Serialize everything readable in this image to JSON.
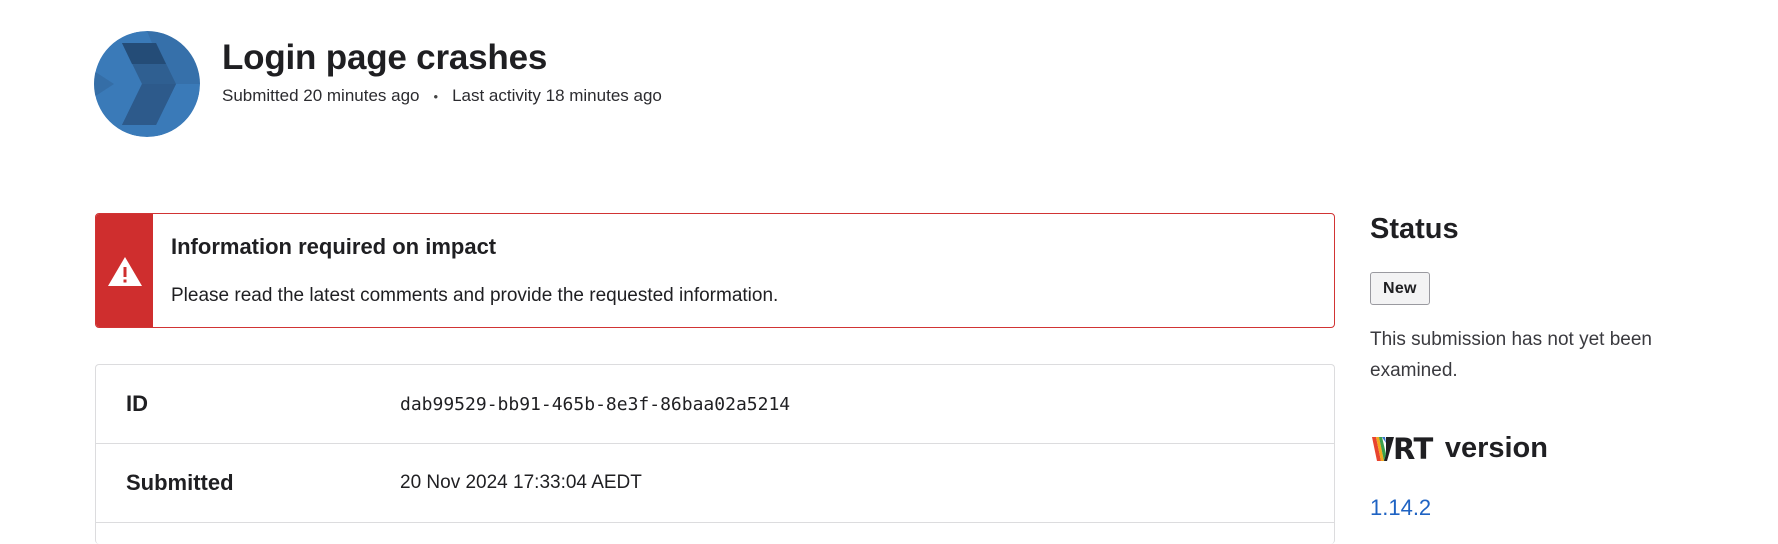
{
  "header": {
    "title": "Login page crashes",
    "submitted": "Submitted 20 minutes ago",
    "separator": "•",
    "last_activity": "Last activity 18 minutes ago"
  },
  "alert": {
    "icon": "warning-triangle-icon",
    "title": "Information required on impact",
    "message": "Please read the latest comments and provide the requested information.",
    "accent_color": "#cf2e2e"
  },
  "details": {
    "rows": [
      {
        "label": "ID",
        "value": "dab99529-bb91-465b-8e3f-86baa02a5214"
      },
      {
        "label": "Submitted",
        "value": "20 Nov 2024 17:33:04 AEDT"
      }
    ]
  },
  "sidebar": {
    "status_heading": "Status",
    "status_badge": "New",
    "status_description": "This submission has not yet been examined.",
    "vrt_logo_text": "RT",
    "vrt_heading": "version",
    "vrt_version": "1.14.2",
    "link_color": "#1f63c3"
  }
}
